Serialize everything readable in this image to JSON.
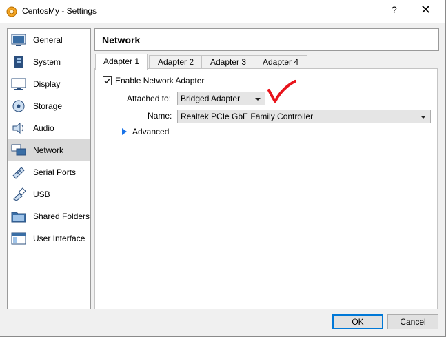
{
  "window": {
    "title": "CentosMy - Settings",
    "help_glyph": "?",
    "close_glyph": "✕"
  },
  "sidebar": {
    "items": [
      {
        "label": "General",
        "icon": "general-icon",
        "selected": false
      },
      {
        "label": "System",
        "icon": "system-icon",
        "selected": false
      },
      {
        "label": "Display",
        "icon": "display-icon",
        "selected": false
      },
      {
        "label": "Storage",
        "icon": "storage-icon",
        "selected": false
      },
      {
        "label": "Audio",
        "icon": "audio-icon",
        "selected": false
      },
      {
        "label": "Network",
        "icon": "network-icon",
        "selected": true
      },
      {
        "label": "Serial Ports",
        "icon": "serial-ports-icon",
        "selected": false
      },
      {
        "label": "USB",
        "icon": "usb-icon",
        "selected": false
      },
      {
        "label": "Shared Folders",
        "icon": "shared-folders-icon",
        "selected": false
      },
      {
        "label": "User Interface",
        "icon": "user-interface-icon",
        "selected": false
      }
    ]
  },
  "header": {
    "title": "Network"
  },
  "tabs": [
    {
      "label": "Adapter 1",
      "active": true
    },
    {
      "label": "Adapter 2",
      "active": false
    },
    {
      "label": "Adapter 3",
      "active": false
    },
    {
      "label": "Adapter 4",
      "active": false
    }
  ],
  "adapter": {
    "enable_label": "Enable Network Adapter",
    "enabled": true,
    "attached_label": "Attached to:",
    "attached_value": "Bridged Adapter",
    "name_label": "Name:",
    "name_value": "Realtek PCIe GbE Family Controller",
    "advanced_label": "Advanced"
  },
  "buttons": {
    "ok": "OK",
    "cancel": "Cancel"
  },
  "colors": {
    "accent": "#0078d7",
    "annotation": "#e8141c",
    "selected_bg": "#d9d9d9"
  }
}
